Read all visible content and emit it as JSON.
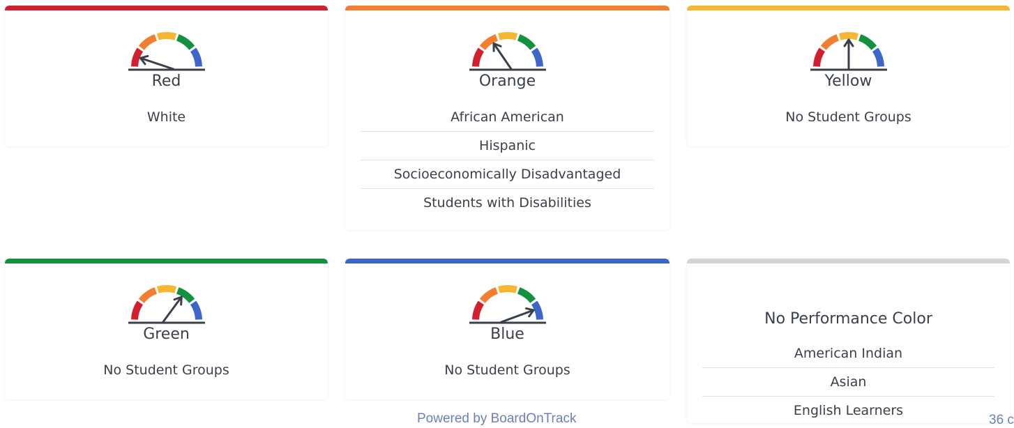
{
  "colors": {
    "red": "#d21f2d",
    "orange": "#f37e2f",
    "yellow": "#f6b533",
    "green": "#12913f",
    "blue": "#3c66c8",
    "gray": "#d4d4d4",
    "needle": "#3a3f48"
  },
  "cards": [
    {
      "label": "Red",
      "gauge_level": "red",
      "groups": [
        "White"
      ]
    },
    {
      "label": "Orange",
      "gauge_level": "orange",
      "groups": [
        "African American",
        "Hispanic",
        "Socioeconomically Disadvantaged",
        "Students with Disabilities"
      ]
    },
    {
      "label": "Yellow",
      "gauge_level": "yellow",
      "groups": [
        "No Student Groups"
      ]
    },
    {
      "label": "Green",
      "gauge_level": "green",
      "groups": [
        "No Student Groups"
      ]
    },
    {
      "label": "Blue",
      "gauge_level": "blue",
      "groups": [
        "No Student Groups"
      ]
    },
    {
      "label": "No Performance Color",
      "gauge_level": "none",
      "groups": [
        "American Indian",
        "Asian",
        "English Learners"
      ]
    }
  ],
  "footer": {
    "text": "Powered by BoardOnTrack",
    "page": "36 c"
  }
}
